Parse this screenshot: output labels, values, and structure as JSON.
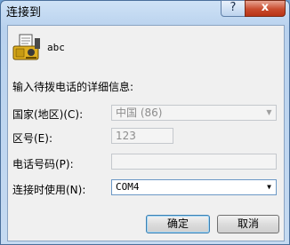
{
  "window": {
    "title": "连接到",
    "help_glyph": "?",
    "close_glyph": "x"
  },
  "connection": {
    "name": "abc",
    "icon": "phone-connection-icon"
  },
  "prompt": "输入待拨电话的详细信息:",
  "fields": {
    "country": {
      "label": "国家(地区)(C):",
      "value": "中国 (86)"
    },
    "area_code": {
      "label": "区号(E):",
      "value": "123"
    },
    "phone": {
      "label": "电话号码(P):",
      "value": ""
    },
    "connect_using": {
      "label": "连接时使用(N):",
      "value": "COM4"
    }
  },
  "buttons": {
    "ok": "确定",
    "cancel": "取消"
  }
}
